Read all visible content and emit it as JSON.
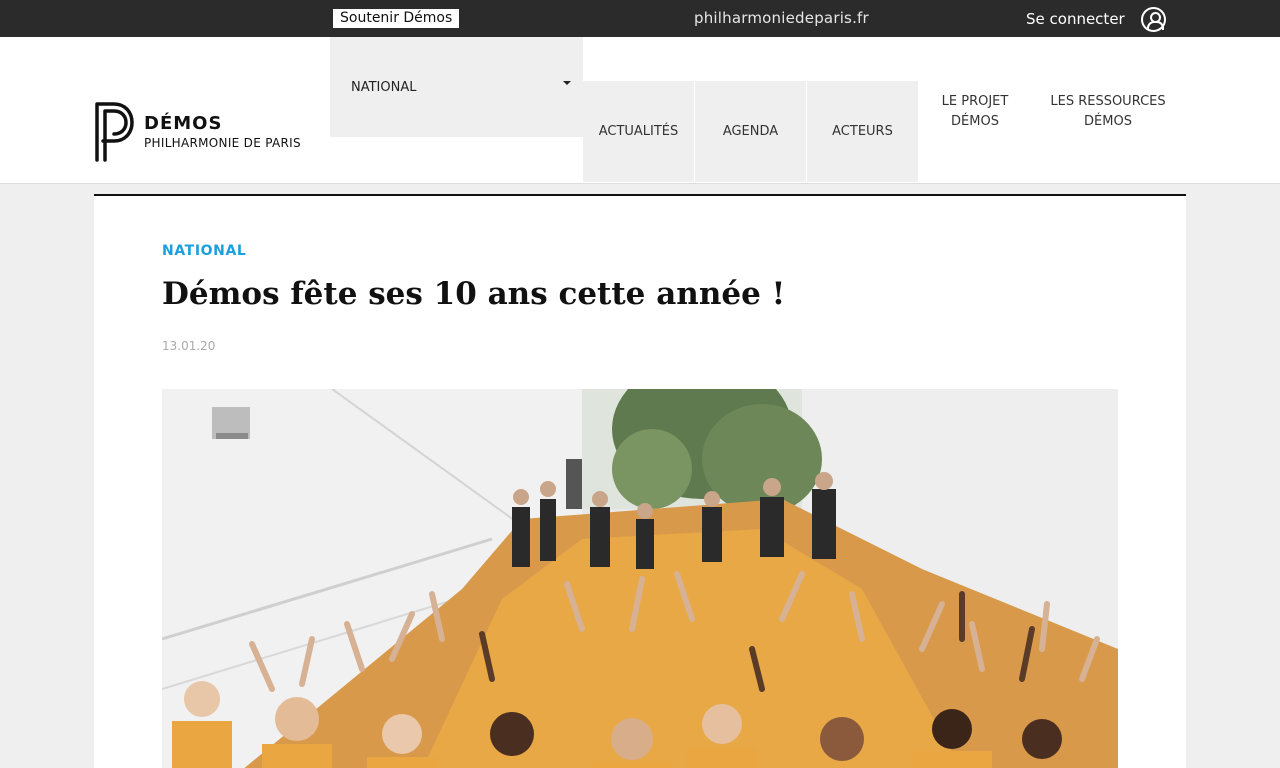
{
  "topbar": {
    "support_label": "Soutenir Démos",
    "site_link": "philharmoniedeparis.fr",
    "login_label": "Se connecter",
    "login_icon": "user-circle-icon"
  },
  "header": {
    "logo_title": "DÉMOS",
    "logo_subtitle": "PHILHARMONIE DE PARIS",
    "dropdown_label": "NATIONAL",
    "nav": [
      {
        "label": "ACTUALITÉS"
      },
      {
        "label": "AGENDA"
      },
      {
        "label": "ACTEURS"
      },
      {
        "line1": "LE PROJET",
        "line2": "DÉMOS"
      },
      {
        "line1": "LES RESSOURCES",
        "line2": "DÉMOS"
      }
    ]
  },
  "article": {
    "category": "NATIONAL",
    "title": "Démos fête ses 10 ans cette année !",
    "date": "13.01.20"
  },
  "colors": {
    "accent": "#1b9fde",
    "topbar": "#2b2b2b",
    "shirt": "#f0a13a"
  }
}
